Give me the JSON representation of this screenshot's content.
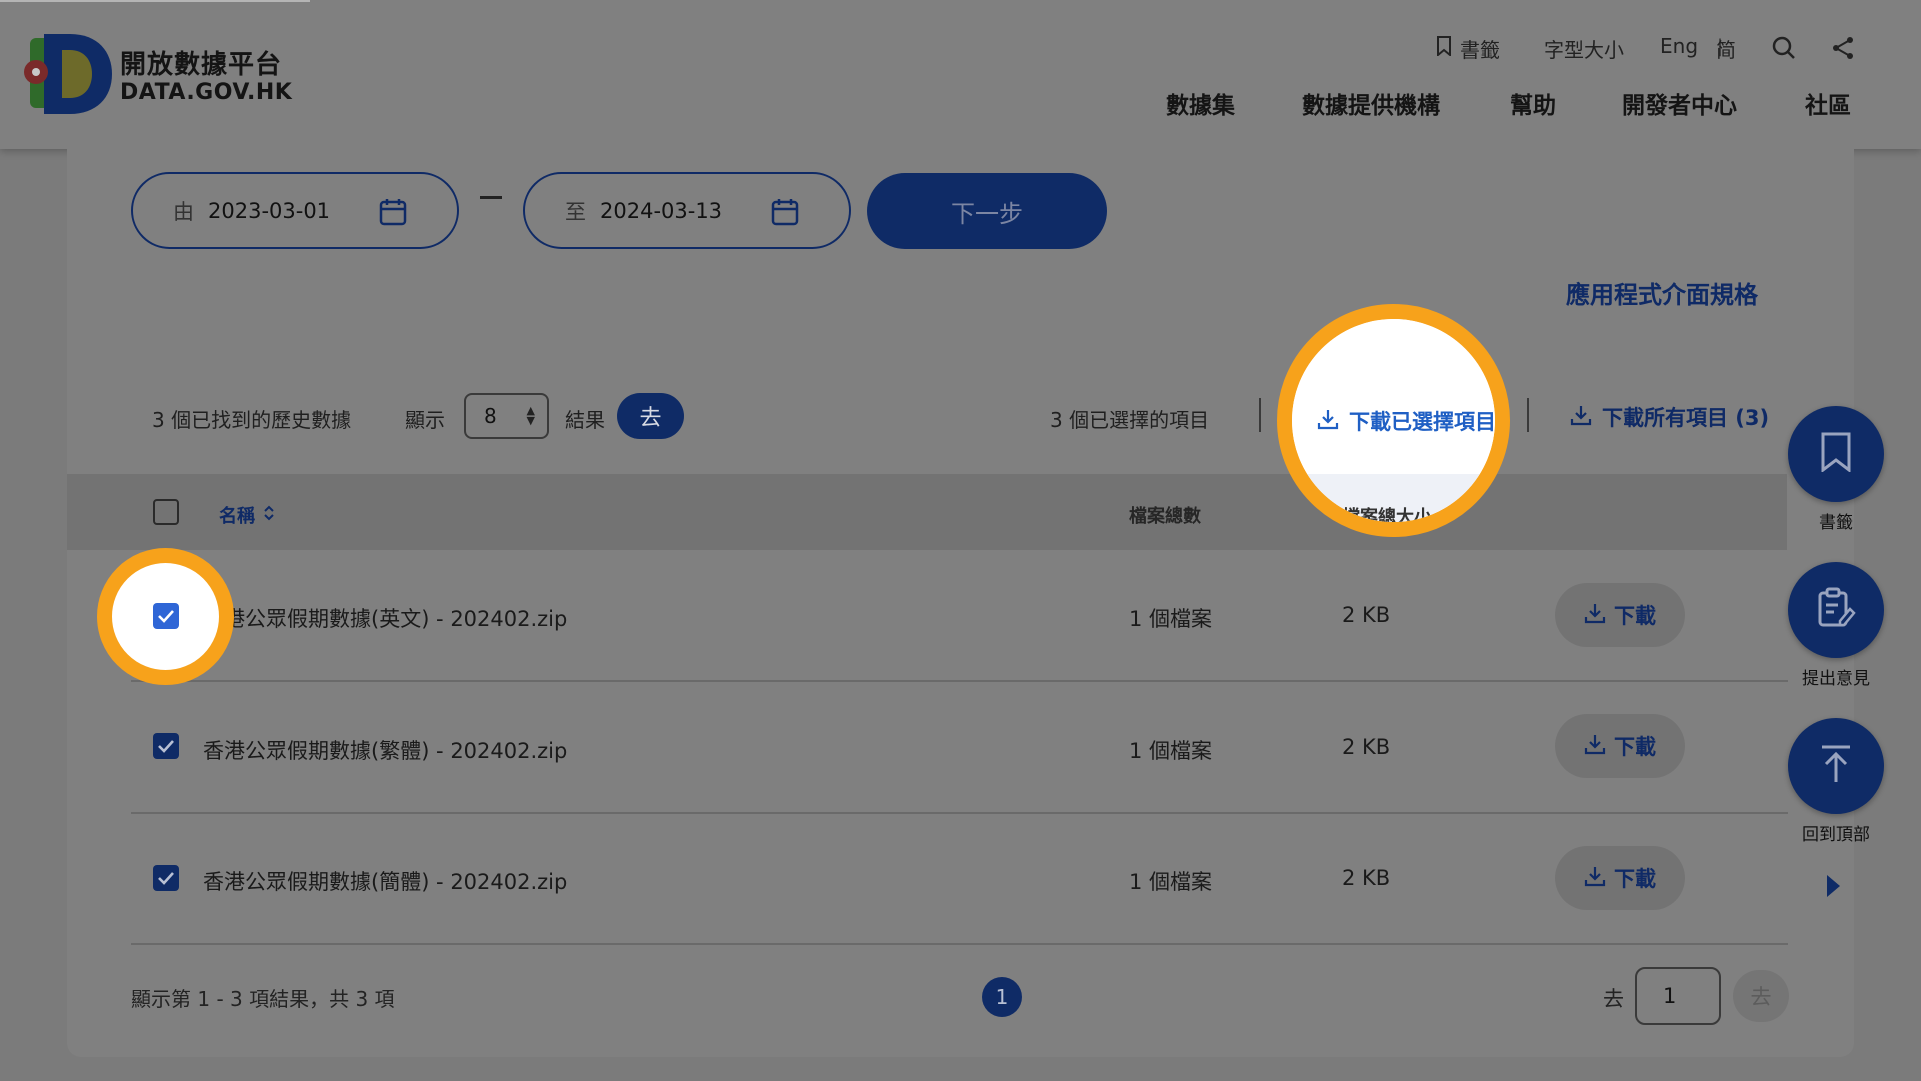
{
  "header": {
    "logo_line1": "開放數據平台",
    "logo_line2": "DATA.GOV.HK",
    "util": {
      "bookmark": "書籤",
      "font_size": "字型大小",
      "lang_en": "Eng",
      "lang_sep": "|",
      "lang_sc": "简"
    },
    "nav": [
      "數據集",
      "數據提供機構",
      "幫助",
      "開發者中心",
      "社區"
    ]
  },
  "filters": {
    "from_prefix": "由",
    "from_date": "2023-03-01",
    "to_prefix": "至",
    "to_date": "2024-03-13",
    "next_label": "下一步"
  },
  "api_link": "應用程式介面規格",
  "toolbar": {
    "found_text": "3 個已找到的歷史數據",
    "show_label": "顯示",
    "page_size": "8",
    "results_label": "結果",
    "go_label": "去",
    "selected_text": "3 個已選擇的項目",
    "download_selected": "下載已選擇項目",
    "download_all": "下載所有項目 (3)"
  },
  "table": {
    "col_name": "名稱",
    "col_count": "檔案總數",
    "col_size": "檔案總大小",
    "rows": [
      {
        "name": "香港公眾假期數據(英文) - 202402.zip",
        "count": "1 個檔案",
        "size": "2 KB",
        "action": "下載",
        "checked": true
      },
      {
        "name": "香港公眾假期數據(繁體) - 202402.zip",
        "count": "1 個檔案",
        "size": "2 KB",
        "action": "下載",
        "checked": true
      },
      {
        "name": "香港公眾假期數據(簡體) - 202402.zip",
        "count": "1 個檔案",
        "size": "2 KB",
        "action": "下載",
        "checked": true
      }
    ]
  },
  "footer": {
    "summary": "顯示第 1 - 3 項結果，共 3 項",
    "current_page": "1",
    "goto_label": "去",
    "goto_value": "1",
    "goto_button": "去"
  },
  "fabs": {
    "bookmark": "書籤",
    "feedback": "提出意見",
    "top": "回到頂部"
  },
  "colors": {
    "highlight_ring": "#f7a21b",
    "primary": "#0f2b66",
    "link_blue": "#1f5fc4",
    "overlay_bg": "#7b7b7b"
  }
}
